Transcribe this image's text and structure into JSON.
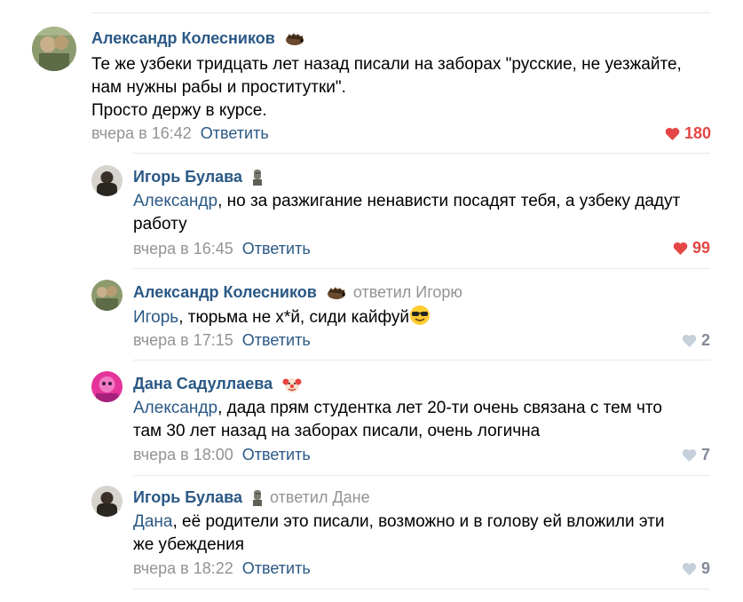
{
  "comments": [
    {
      "author": "Александр Колесников",
      "replied_to": "",
      "mention": "",
      "text_lines": [
        "Те же узбеки тридцать лет назад писали на заборах \"русские, не уезжайте,",
        "нам нужны рабы и проститутки\".",
        "Просто держу в курсе."
      ],
      "date": "вчера в 16:42",
      "reply_label": "Ответить",
      "likes": "180"
    },
    {
      "author": "Игорь Булава",
      "replied_to": "",
      "mention": "Александр",
      "text_lines": [
        ", но за разжигание ненависти посадят тебя, а узбеку дадут",
        "работу"
      ],
      "date": "вчера в 16:45",
      "reply_label": "Ответить",
      "likes": "99"
    },
    {
      "author": "Александр Колесников",
      "replied_to": "ответил Игорю",
      "mention": "Игорь",
      "text_lines": [
        ", тюрьма не х*й, сиди кайфуй"
      ],
      "date": "вчера в 17:15",
      "reply_label": "Ответить",
      "likes": "2"
    },
    {
      "author": "Дана Садуллаева",
      "replied_to": "",
      "mention": "Александр",
      "text_lines": [
        ", дада прям студентка лет 20-ти очень связана с тем что",
        "там 30 лет назад на заборах писали, очень логична"
      ],
      "date": "вчера в 18:00",
      "reply_label": "Ответить",
      "likes": "7"
    },
    {
      "author": "Игорь Булава",
      "replied_to": "ответил Дане",
      "mention": "Дана",
      "text_lines": [
        ", её родители это писали, возможно и в голову ей вложили эти",
        "же убеждения"
      ],
      "date": "вчера в 18:22",
      "reply_label": "Ответить",
      "likes": "9"
    }
  ],
  "icons": {
    "liked_heart": "heart-filled-icon",
    "heart": "heart-icon",
    "sticker_hedgehog": "hedgehog-sticker-icon",
    "sticker_statue": "statue-sticker-icon",
    "sticker_clown": "clown-sticker-icon",
    "emoji_sunglasses": "sunglasses-emoji-icon"
  },
  "colors": {
    "link": "#2a5885",
    "muted": "#939393",
    "liked": "#e64646",
    "like_muted": "#828a99",
    "divider": "#e7e8ec"
  }
}
